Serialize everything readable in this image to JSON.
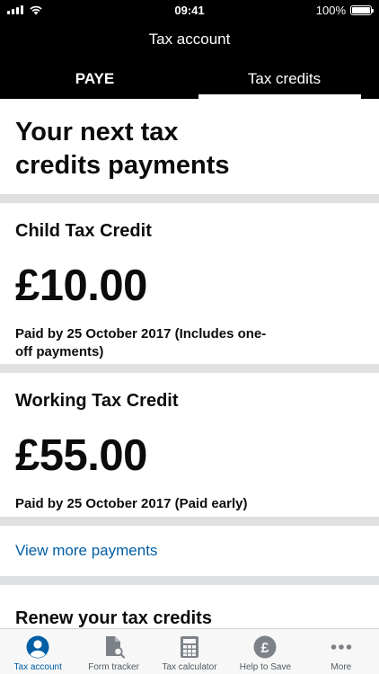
{
  "status_bar": {
    "time": "09:41",
    "battery": "100%",
    "battery_level": 1.0
  },
  "header": {
    "title": "Tax account"
  },
  "tabs": [
    {
      "label": "PAYE",
      "active": false
    },
    {
      "label": "Tax credits",
      "active": true
    }
  ],
  "main": {
    "title_line1": "Your next tax",
    "title_line2": "credits payments",
    "payments": [
      {
        "name": "Child Tax Credit",
        "amount": "£10.00",
        "paid_by_line1": "Paid by 25 October 2017 (Includes one-",
        "paid_by_line2": "off payments)"
      },
      {
        "name": "Working Tax Credit",
        "amount": "£55.00",
        "paid_by": "Paid by 25 October 2017 (Paid early)"
      }
    ],
    "view_more": "View more payments",
    "renew_title": "Renew your tax credits"
  },
  "tabbar": {
    "items": [
      {
        "label": "Tax account",
        "icon": "person-icon",
        "active": true
      },
      {
        "label": "Form tracker",
        "icon": "document-search-icon",
        "active": false
      },
      {
        "label": "Tax calculator",
        "icon": "calculator-icon",
        "active": false
      },
      {
        "label": "Help to Save",
        "icon": "pound-coin-icon",
        "active": false
      },
      {
        "label": "More",
        "icon": "more-dots-icon",
        "active": false
      }
    ]
  },
  "colors": {
    "accent": "#005ea5",
    "header_bg": "#000000",
    "divider": "#dee0e2"
  }
}
